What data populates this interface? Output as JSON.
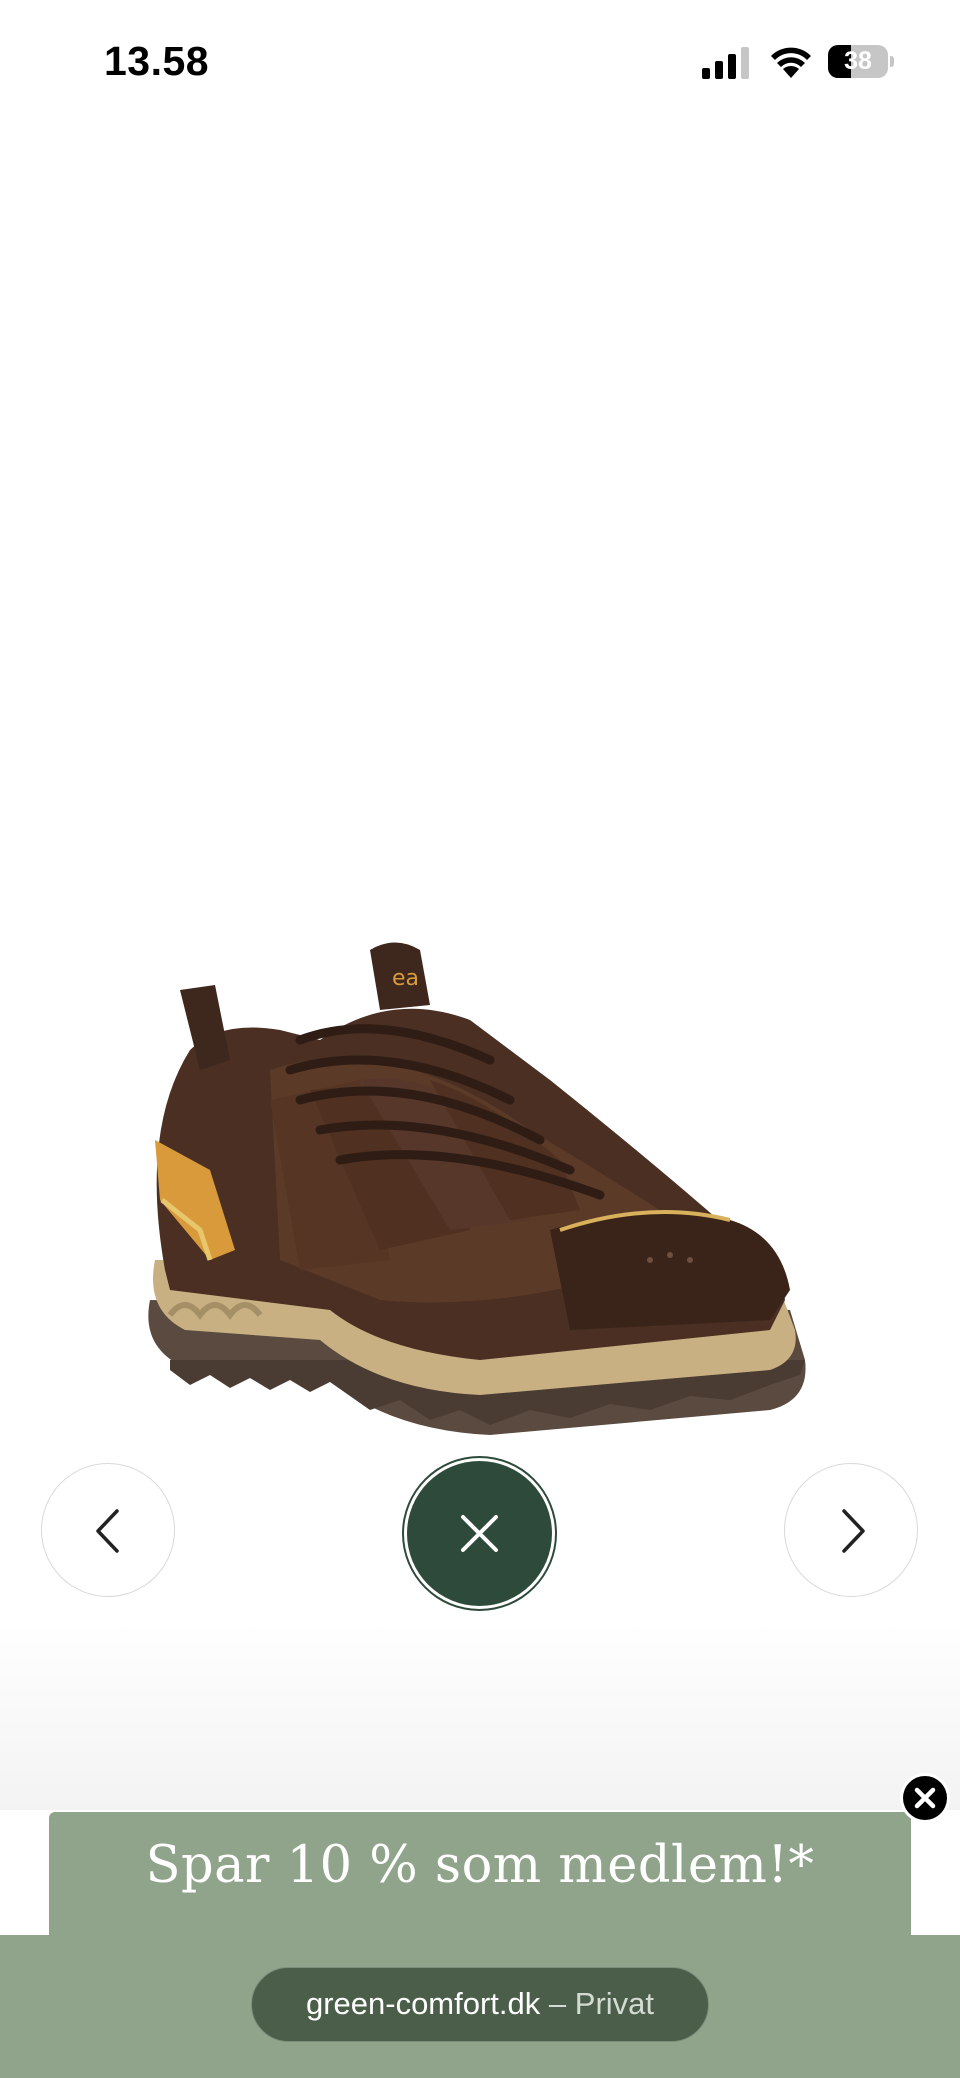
{
  "status_bar": {
    "time": "13.58",
    "battery_level": "38",
    "battery_fraction": 0.38
  },
  "product": {
    "image_icon": "hiking-shoe-image",
    "logo_text": "ea",
    "colors": {
      "upper": "#4a2f22",
      "accent": "#d99a3c",
      "sole": "#c8b083",
      "outsole": "#5a4a40"
    }
  },
  "controls": {
    "prev_icon": "chevron-left-icon",
    "next_icon": "chevron-right-icon",
    "close_icon": "close-icon",
    "close_color": "#2e4a3b"
  },
  "promo": {
    "text": "Spar 10 % som medlem!*",
    "background": "#8fa48b",
    "close_icon": "close-icon"
  },
  "browser": {
    "domain": "green-comfort.dk",
    "separator": "–",
    "mode": "Privat"
  }
}
